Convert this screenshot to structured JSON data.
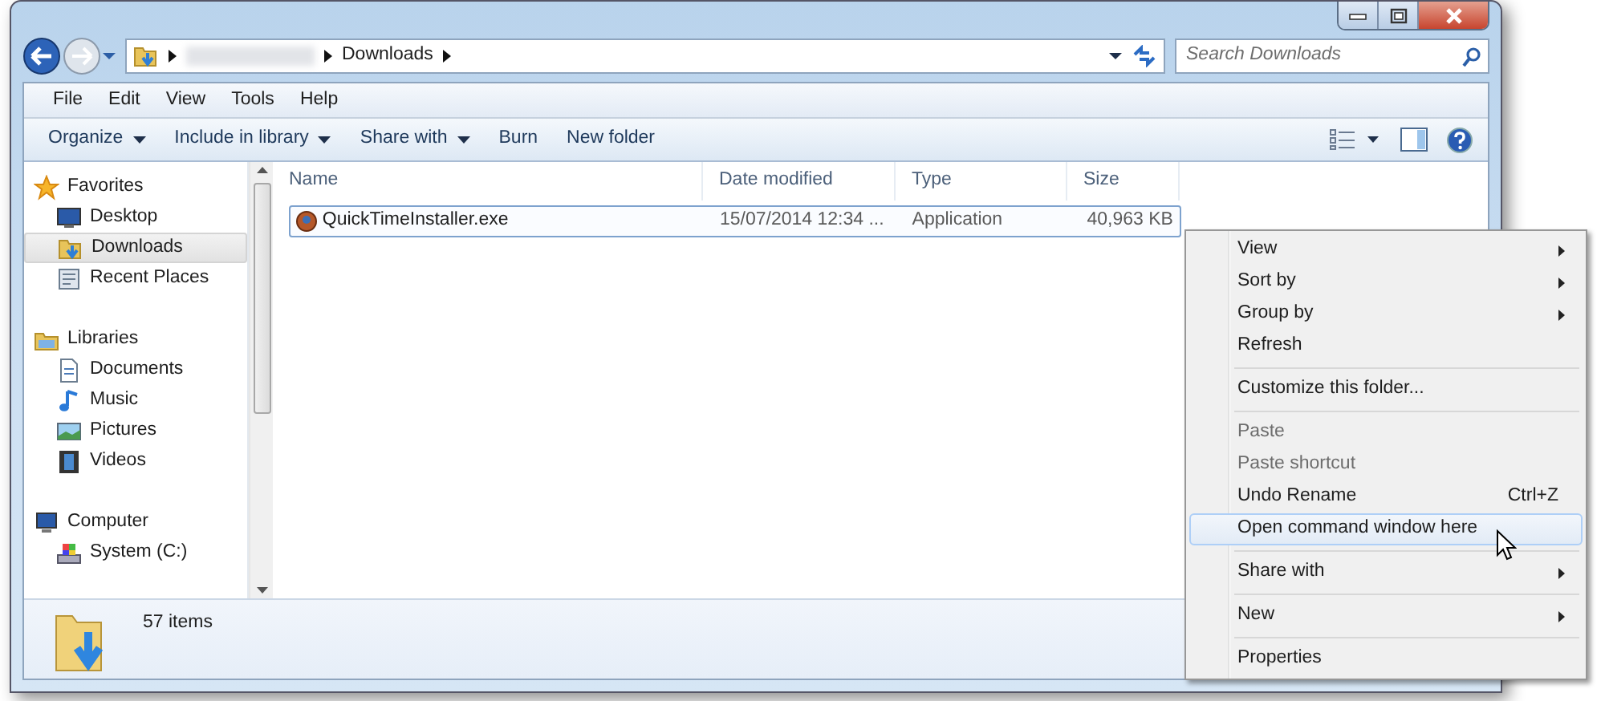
{
  "address": {
    "path": [
      "Downloads"
    ],
    "search_placeholder": "Search Downloads"
  },
  "menu": [
    "File",
    "Edit",
    "View",
    "Tools",
    "Help"
  ],
  "commands": [
    {
      "label": "Organize",
      "dropdown": true
    },
    {
      "label": "Include in library",
      "dropdown": true
    },
    {
      "label": "Share with",
      "dropdown": true
    },
    {
      "label": "Burn",
      "dropdown": false
    },
    {
      "label": "New folder",
      "dropdown": false
    }
  ],
  "navigation": [
    {
      "label": "Favorites",
      "kind": "star",
      "children": [
        {
          "label": "Desktop",
          "kind": "desktop",
          "selected": false
        },
        {
          "label": "Downloads",
          "kind": "downloads",
          "selected": true
        },
        {
          "label": "Recent Places",
          "kind": "recent",
          "selected": false
        }
      ]
    },
    {
      "label": "Libraries",
      "kind": "library",
      "children": [
        {
          "label": "Documents",
          "kind": "document",
          "selected": false
        },
        {
          "label": "Music",
          "kind": "music",
          "selected": false
        },
        {
          "label": "Pictures",
          "kind": "picture",
          "selected": false
        },
        {
          "label": "Videos",
          "kind": "video",
          "selected": false
        }
      ]
    },
    {
      "label": "Computer",
      "kind": "computer",
      "children": [
        {
          "label": "System (C:)",
          "kind": "drive",
          "selected": false
        }
      ]
    }
  ],
  "columns": [
    "Name",
    "Date modified",
    "Type",
    "Size"
  ],
  "files": [
    {
      "name": "QuickTimeInstaller.exe",
      "date_modified": "15/07/2014 12:34 ...",
      "type": "Application",
      "size": "40,963 KB",
      "selected": true
    }
  ],
  "status_bar": {
    "item_count": "57 items"
  },
  "context_menu": [
    {
      "kind": "item",
      "label": "View",
      "submenu": true,
      "disabled": false,
      "selected": false
    },
    {
      "kind": "item",
      "label": "Sort by",
      "submenu": true,
      "disabled": false,
      "selected": false
    },
    {
      "kind": "item",
      "label": "Group by",
      "submenu": true,
      "disabled": false,
      "selected": false
    },
    {
      "kind": "item",
      "label": "Refresh",
      "submenu": false,
      "disabled": false,
      "selected": false
    },
    {
      "kind": "separator"
    },
    {
      "kind": "item",
      "label": "Customize this folder...",
      "submenu": false,
      "disabled": false,
      "selected": false
    },
    {
      "kind": "separator"
    },
    {
      "kind": "item",
      "label": "Paste",
      "submenu": false,
      "disabled": true,
      "selected": false
    },
    {
      "kind": "item",
      "label": "Paste shortcut",
      "submenu": false,
      "disabled": true,
      "selected": false
    },
    {
      "kind": "item",
      "label": "Undo Rename",
      "shortcut": "Ctrl+Z",
      "submenu": false,
      "disabled": false,
      "selected": false
    },
    {
      "kind": "item",
      "label": "Open command window here",
      "submenu": false,
      "disabled": false,
      "selected": true
    },
    {
      "kind": "separator"
    },
    {
      "kind": "item",
      "label": "Share with",
      "submenu": true,
      "disabled": false,
      "selected": false
    },
    {
      "kind": "separator"
    },
    {
      "kind": "item",
      "label": "New",
      "submenu": true,
      "disabled": false,
      "selected": false
    },
    {
      "kind": "separator"
    },
    {
      "kind": "item",
      "label": "Properties",
      "submenu": false,
      "disabled": false,
      "selected": false
    }
  ]
}
